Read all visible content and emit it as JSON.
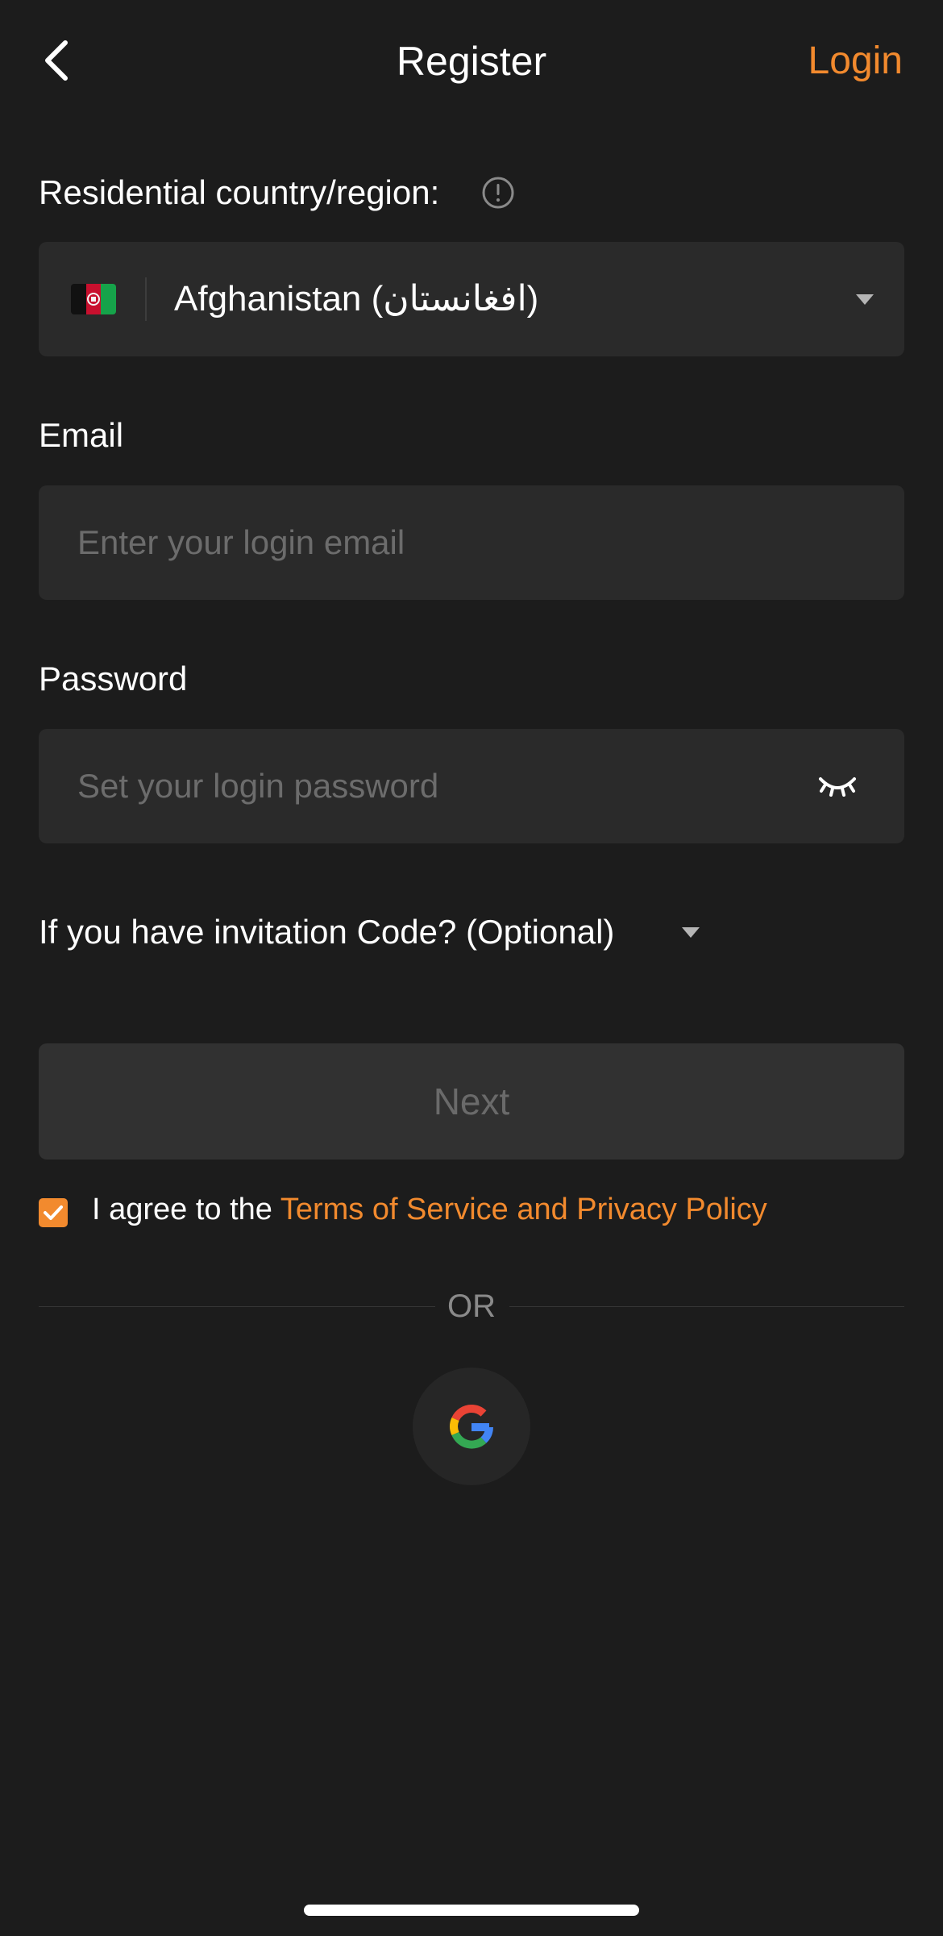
{
  "header": {
    "title": "Register",
    "login_label": "Login",
    "back_icon": "chevron-left-icon"
  },
  "country": {
    "label": "Residential country/region:",
    "info_icon": "info-icon",
    "value": "Afghanistan (افغانستان)",
    "flag": "afghanistan-flag",
    "dropdown_icon": "caret-down-icon"
  },
  "email": {
    "label": "Email",
    "placeholder": "Enter your login email",
    "value": ""
  },
  "password": {
    "label": "Password",
    "placeholder": "Set your login password",
    "value": "",
    "toggle_icon": "eye-closed-icon"
  },
  "invitation": {
    "label": "If you have invitation Code? (Optional)",
    "toggle_icon": "caret-down-icon"
  },
  "next_button": {
    "label": "Next",
    "enabled": false
  },
  "agreement": {
    "checked": true,
    "prefix": "I agree to the ",
    "link_text": "Terms of Service and Privacy Policy"
  },
  "divider": {
    "text": "OR"
  },
  "social": {
    "google_icon": "google-icon"
  },
  "colors": {
    "background": "#1c1c1c",
    "field": "#2a2a2a",
    "accent": "#f28a2e",
    "placeholder": "#6c6c6c",
    "disabled_button": "#313131"
  }
}
